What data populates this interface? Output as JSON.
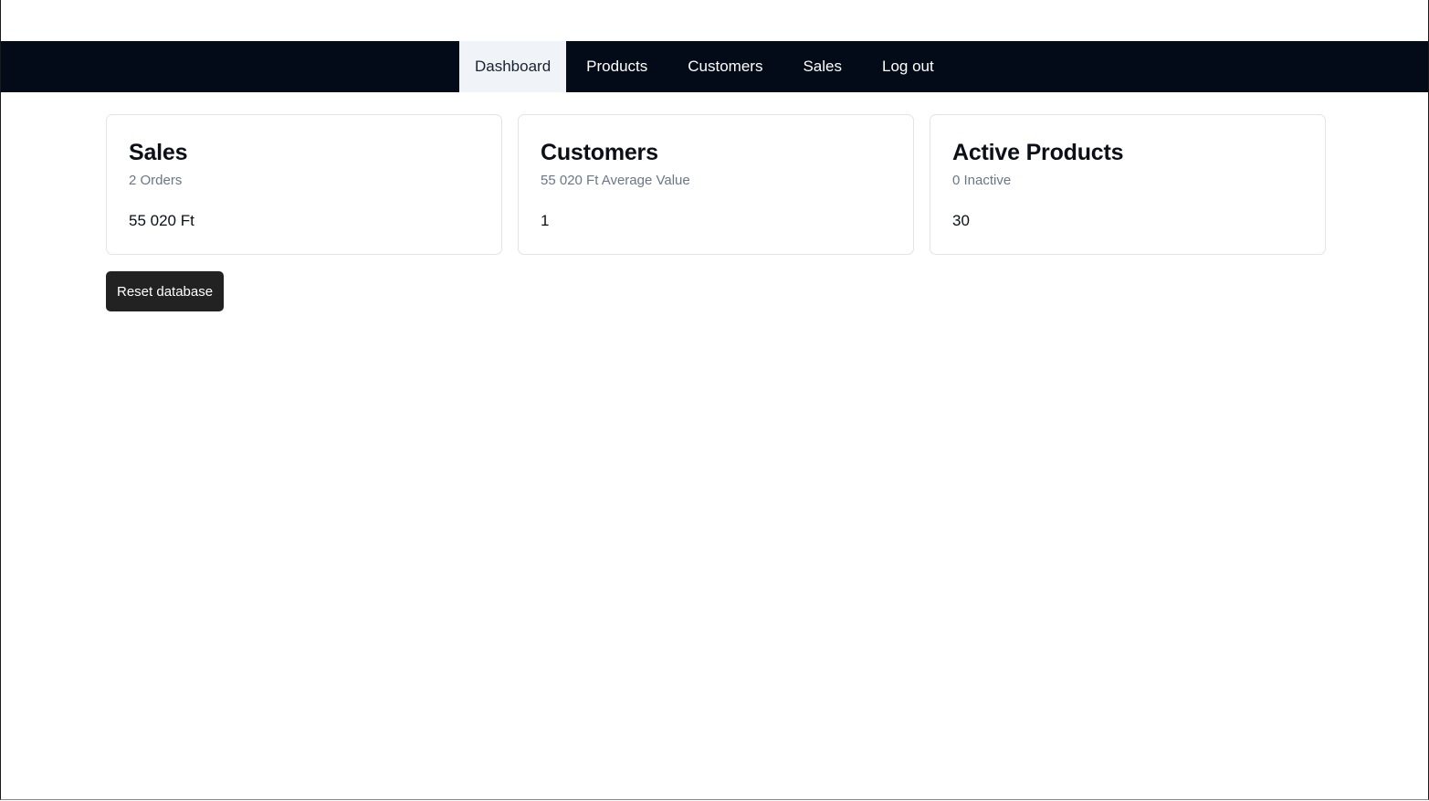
{
  "nav": {
    "items": [
      {
        "label": "Dashboard",
        "active": true
      },
      {
        "label": "Products",
        "active": false
      },
      {
        "label": "Customers",
        "active": false
      },
      {
        "label": "Sales",
        "active": false
      },
      {
        "label": "Log out",
        "active": false
      }
    ]
  },
  "cards": [
    {
      "title": "Sales",
      "subtitle": "2 Orders",
      "value": "55 020 Ft"
    },
    {
      "title": "Customers",
      "subtitle": "55 020 Ft Average Value",
      "value": "1"
    },
    {
      "title": "Active Products",
      "subtitle": "0 Inactive",
      "value": "30"
    }
  ],
  "actions": {
    "reset_label": "Reset database"
  },
  "colors": {
    "navbar_bg": "#030a18",
    "active_tab_bg": "#f0f4f9",
    "button_bg": "#222222",
    "muted_text": "#6b7788"
  }
}
